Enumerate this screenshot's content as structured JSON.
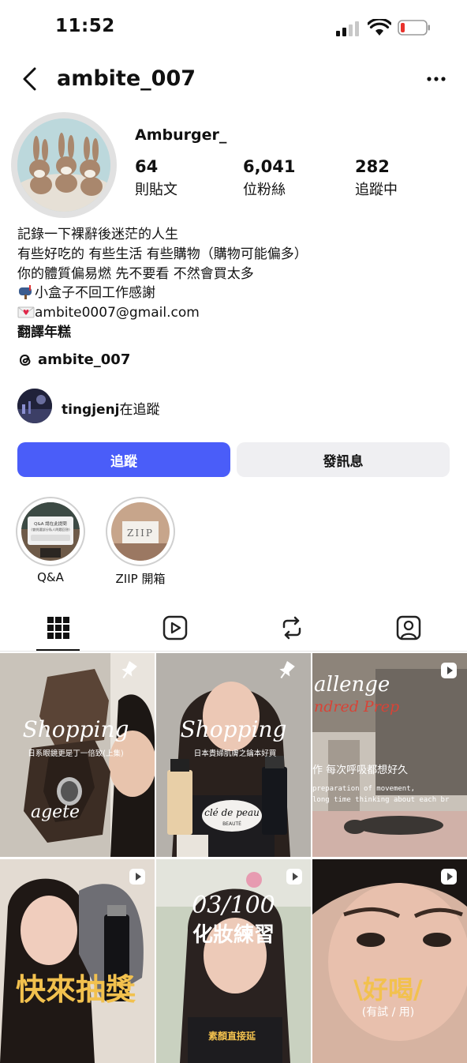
{
  "status_bar": {
    "time": "11:52",
    "icons": [
      "signal-icon",
      "wifi-icon",
      "battery-low-icon"
    ]
  },
  "header": {
    "username": "ambite_007",
    "back_icon": "chevron-left-icon",
    "more_icon": "ellipsis-icon"
  },
  "profile": {
    "display_name": "Amburger_",
    "stats": [
      {
        "value": "64",
        "label": "則貼文"
      },
      {
        "value": "6,041",
        "label": "位粉絲"
      },
      {
        "value": "282",
        "label": "追蹤中"
      }
    ],
    "bio": [
      "記錄一下裸辭後迷茫的人生",
      "有些好吃的 有些生活 有些購物（購物可能偏多）",
      "你的體質偏易燃 先不要看 不然會買太多",
      "小盒子不回工作感謝",
      "ambite0007@gmail.com",
      "翻譯年糕"
    ],
    "threads_handle": "ambite_007",
    "followed_by": {
      "username": "tingjenj",
      "suffix": "在追蹤"
    }
  },
  "actions": {
    "follow_label": "追蹤",
    "message_label": "發訊息"
  },
  "highlights": [
    {
      "label": "Q&A",
      "cover_title": "Q&A 請在此提問",
      "cover_subtitle": "(會挑選部分私人問題回答)"
    },
    {
      "label": "ZIIP 開箱",
      "cover_text": "ZIIP"
    }
  ],
  "tabs": [
    {
      "name": "posts-grid",
      "icon": "grid-icon",
      "active": true
    },
    {
      "name": "reels",
      "icon": "reels-icon",
      "active": false
    },
    {
      "name": "reposts",
      "icon": "repost-icon",
      "active": false
    },
    {
      "name": "tagged",
      "icon": "tagged-person-icon",
      "active": false
    }
  ],
  "posts": [
    {
      "badge": "pin-icon",
      "title": "Shopping",
      "subtitle": "日系眼鏡更是丁一倍致(上集)",
      "caption": "agete"
    },
    {
      "badge": "pin-icon",
      "title": "Shopping",
      "subtitle": "日本貴婦肌膚之鑰本好買",
      "caption": "clé de peau",
      "caption2": "BEAUTÉ"
    },
    {
      "badge": "reel-icon",
      "title": "allenge",
      "subtitle": "ndred Prep",
      "caption": "作 每次呼吸都想好久",
      "caption2": "preparation of movement,",
      "caption3": "long time thinking about each br"
    },
    {
      "badge": "reel-icon",
      "title": "快來抽獎"
    },
    {
      "badge": "reel-icon",
      "title": "03/100",
      "subtitle": "化妝練習",
      "caption": "素顏直接延"
    },
    {
      "badge": "reel-icon",
      "title": "\\好喝/",
      "subtitle": "(有試 / 用)"
    }
  ]
}
